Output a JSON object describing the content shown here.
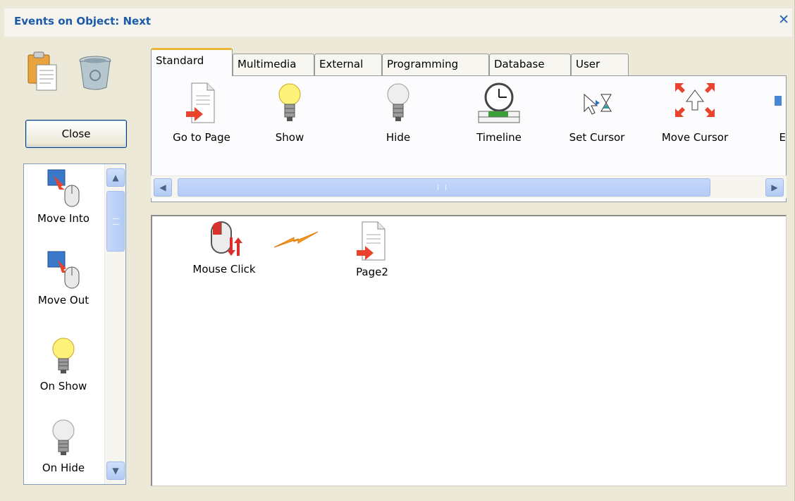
{
  "window": {
    "title": "Events on Object: Next",
    "close_glyph": "✕"
  },
  "left_panel": {
    "close_button_label": "Close",
    "icons": [
      "paste-icon",
      "recycle-bin-icon"
    ],
    "events": [
      {
        "label": "Move Into",
        "icon": "move-into-icon"
      },
      {
        "label": "Move Out",
        "icon": "move-out-icon"
      },
      {
        "label": "On Show",
        "icon": "lightbulb-on-icon"
      },
      {
        "label": "On Hide",
        "icon": "lightbulb-off-icon"
      }
    ]
  },
  "tabs": [
    {
      "label": "Standard",
      "active": true
    },
    {
      "label": "Multimedia",
      "active": false
    },
    {
      "label": "External",
      "active": false
    },
    {
      "label": "Programming",
      "active": false
    },
    {
      "label": "Database",
      "active": false
    },
    {
      "label": "User",
      "active": false
    }
  ],
  "actions": [
    {
      "label": "Go to Page",
      "icon": "go-to-page-icon"
    },
    {
      "label": "Show",
      "icon": "lightbulb-on-icon"
    },
    {
      "label": "Hide",
      "icon": "lightbulb-off-icon"
    },
    {
      "label": "Timeline",
      "icon": "timeline-clock-icon"
    },
    {
      "label": "Set Cursor",
      "icon": "set-cursor-icon"
    },
    {
      "label": "Move Cursor",
      "icon": "move-cursor-icon"
    },
    {
      "label": "E",
      "icon": "partial-action-icon"
    }
  ],
  "canvas": {
    "event_node": {
      "label": "Mouse Click",
      "icon": "mouse-click-icon"
    },
    "connector_icon": "lightning-icon",
    "action_node": {
      "label": "Page2",
      "icon": "go-to-page-icon"
    }
  },
  "colors": {
    "title": "#1d5aa8",
    "active_tab_accent": "#f0b637",
    "scrollbar": "#b4cbf5"
  }
}
